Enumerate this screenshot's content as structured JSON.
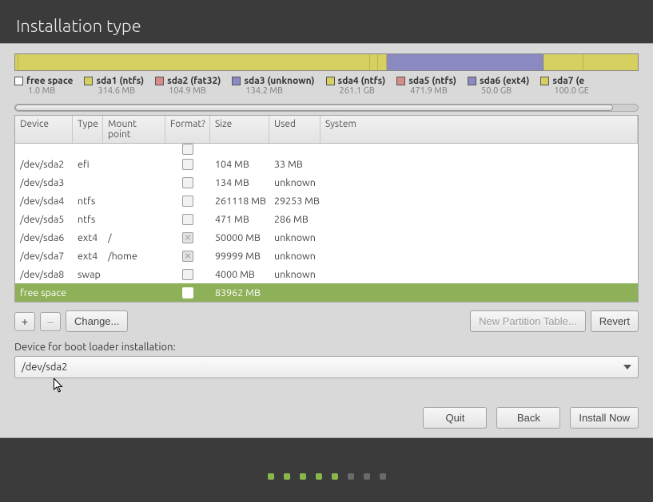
{
  "header": {
    "title": "Installation type"
  },
  "viz": {
    "segments": [
      {
        "color": "#d6d060",
        "flex": 0.3
      },
      {
        "color": "#d6d060",
        "flex": 45
      },
      {
        "color": "#d6d060",
        "flex": 1
      },
      {
        "color": "#d6d060",
        "flex": 1
      },
      {
        "color": "#8b89c2",
        "flex": 20
      },
      {
        "color": "#d6d060",
        "flex": 5
      },
      {
        "color": "#d6d060",
        "flex": 7
      }
    ]
  },
  "legend": [
    {
      "swatch": "#ffffff",
      "name": "free space",
      "size": "1.0 MB"
    },
    {
      "swatch": "#d6d060",
      "name": "sda1 (ntfs)",
      "size": "314.6 MB"
    },
    {
      "swatch": "#d88b8b",
      "name": "sda2 (fat32)",
      "size": "104.9 MB"
    },
    {
      "swatch": "#8b89c2",
      "name": "sda3 (unknown)",
      "size": "134.2 MB"
    },
    {
      "swatch": "#d6d060",
      "name": "sda4 (ntfs)",
      "size": "261.1 GB"
    },
    {
      "swatch": "#d88b8b",
      "name": "sda5 (ntfs)",
      "size": "471.9 MB"
    },
    {
      "swatch": "#8b89c2",
      "name": "sda6 (ext4)",
      "size": "50.0 GB"
    },
    {
      "swatch": "#d6d060",
      "name": "sda7 (e",
      "size": "100.0 GE"
    }
  ],
  "table": {
    "headers": {
      "device": "Device",
      "type": "Type",
      "mount": "Mount point",
      "format": "Format?",
      "size": "Size",
      "used": "Used",
      "system": "System"
    },
    "rows": [
      {
        "device": "/dev/sda2",
        "type": "efi",
        "mount": "",
        "fmt": "unchecked",
        "size": "104 MB",
        "used": "33 MB",
        "system": ""
      },
      {
        "device": "/dev/sda3",
        "type": "",
        "mount": "",
        "fmt": "unchecked",
        "size": "134 MB",
        "used": "unknown",
        "system": ""
      },
      {
        "device": "/dev/sda4",
        "type": "ntfs",
        "mount": "",
        "fmt": "unchecked",
        "size": "261118 MB",
        "used": "29253 MB",
        "system": ""
      },
      {
        "device": "/dev/sda5",
        "type": "ntfs",
        "mount": "",
        "fmt": "unchecked",
        "size": "471 MB",
        "used": "286 MB",
        "system": ""
      },
      {
        "device": "/dev/sda6",
        "type": "ext4",
        "mount": "/",
        "fmt": "disabled",
        "size": "50000 MB",
        "used": "unknown",
        "system": ""
      },
      {
        "device": "/dev/sda7",
        "type": "ext4",
        "mount": "/home",
        "fmt": "disabled",
        "size": "99999 MB",
        "used": "unknown",
        "system": ""
      },
      {
        "device": "/dev/sda8",
        "type": "swap",
        "mount": "",
        "fmt": "unchecked",
        "size": "4000 MB",
        "used": "unknown",
        "system": ""
      },
      {
        "device": "free space",
        "type": "",
        "mount": "",
        "fmt": "selwhite",
        "size": "83962 MB",
        "used": "",
        "system": "",
        "selected": true
      }
    ]
  },
  "toolbar": {
    "add": "+",
    "remove": "–",
    "change": "Change...",
    "new_table": "New Partition Table...",
    "revert": "Revert"
  },
  "bootloader": {
    "label": "Device for boot loader installation:",
    "value": "/dev/sda2"
  },
  "nav": {
    "quit": "Quit",
    "back": "Back",
    "install": "Install Now"
  },
  "progress": {
    "total": 8,
    "active": 5
  }
}
